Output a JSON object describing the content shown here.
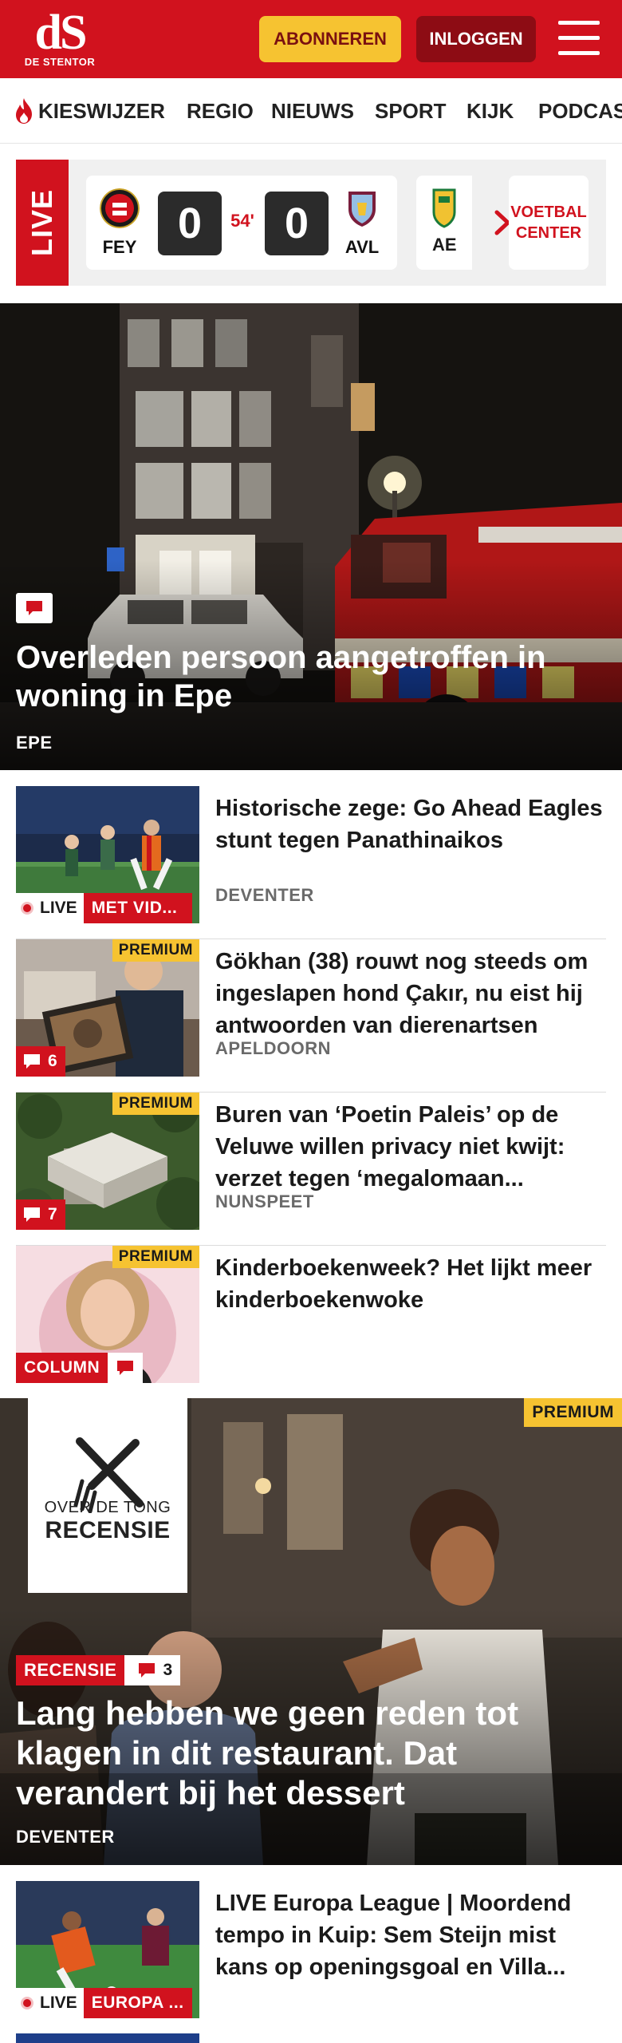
{
  "header": {
    "logo_mark": "dS",
    "logo_text": "DE STENTOR",
    "subscribe_label": "ABONNEREN",
    "login_label": "INLOGGEN",
    "brand_color": "#d1121e"
  },
  "nav": {
    "items": [
      "KIESWIJZER",
      "REGIO",
      "NIEUWS",
      "SPORT",
      "KIJK",
      "PODCAST"
    ]
  },
  "live_scores": {
    "live_label": "LIVE",
    "match": {
      "home": "FEY",
      "away": "AVL",
      "home_score": "0",
      "away_score": "0",
      "minute": "54'"
    },
    "next_match_team": "AE",
    "football_center_line1": "VOETBAL",
    "football_center_line2": "CENTER"
  },
  "hero": {
    "title": "Overleden persoon aangetroffen in woning in Epe",
    "label": "EPE"
  },
  "articles": [
    {
      "title": "Historische zege: Go Ahead Eagles stunt tegen Panathinai­kos",
      "label": "DEVENTER",
      "live_label": "LIVE",
      "tag": "MET VID..."
    },
    {
      "title": "Gökhan (38) rouwt nog steeds om ingeslapen hond Çakır, nu eist hij antwoorden van dierenartsen",
      "label": "APELDOORN",
      "premium": "PREMIUM",
      "comments": "6"
    },
    {
      "title": "Buren van ‘Poetin Paleis’ op de Veluwe willen privacy niet kwijt: verzet tegen ‘megalomaan...",
      "label": "NUNSPEET",
      "premium": "PREMIUM",
      "comments": "7"
    },
    {
      "title": "Kinderboekenweek? Het lijkt meer kinderboekenwoke",
      "premium": "PREMIUM",
      "tag": "COLUMN"
    }
  ],
  "hero2": {
    "premium": "PREMIUM",
    "logo_line1": "OVER DE TONG",
    "logo_line2": "RECENSIE",
    "tag": "RECENSIE",
    "comments": "3",
    "title": "Lang hebben we geen reden tot klagen in dit restaurant. Dat verandert bij het dessert",
    "label": "DEVENTER"
  },
  "article_bottom": {
    "title": "LIVE Europa League | Moordend tempo in Kuip: Sem Steijn mist kans op openingsgoal en Villa...",
    "live_label": "LIVE",
    "tag": "EUROPA ..."
  }
}
